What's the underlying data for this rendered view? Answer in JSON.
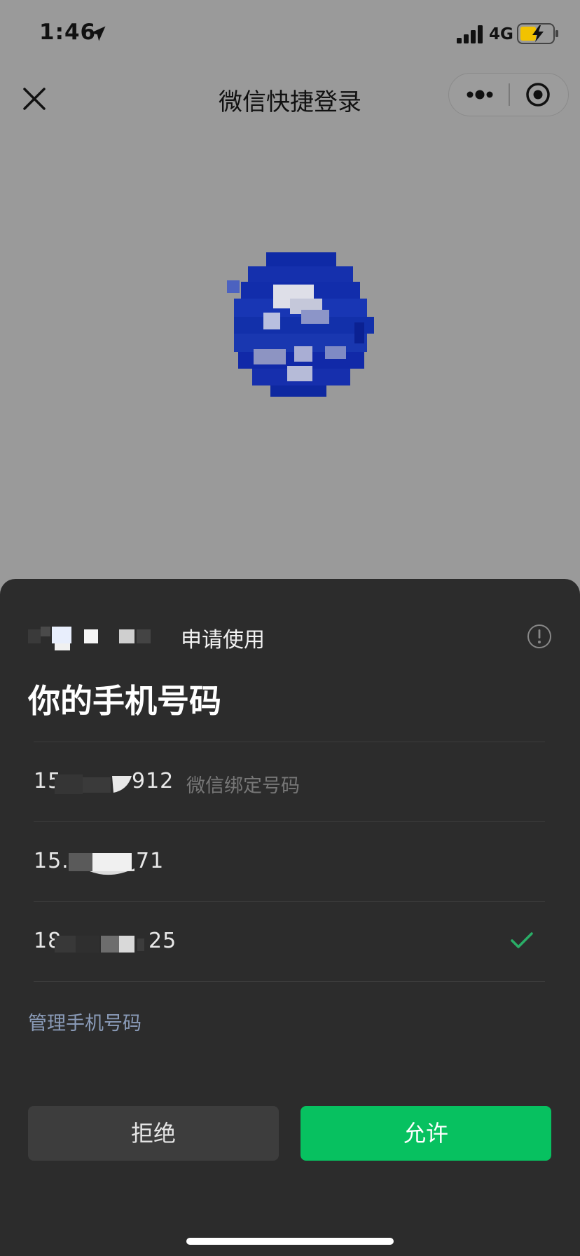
{
  "status_bar": {
    "time": "1:46",
    "network": "4G",
    "icons": [
      "location-arrow-icon",
      "signal-bars-icon",
      "battery-charging-icon"
    ]
  },
  "nav": {
    "title": "微信快捷登录",
    "icons": [
      "close-icon",
      "more-dots-icon",
      "target-icon"
    ]
  },
  "logo": {
    "icon": "app-logo-pixelated",
    "color": "#1a33a8"
  },
  "sheet": {
    "request_label": "申请使用",
    "scope_title": "你的手机号码",
    "phones": [
      {
        "prefix": "15",
        "suffix": "912",
        "tag": "微信绑定号码",
        "selected": false
      },
      {
        "prefix": "15.",
        "suffix": "71",
        "tag": "",
        "selected": false
      },
      {
        "prefix": "18",
        "suffix": "25",
        "tag": "",
        "selected": true
      }
    ],
    "manage_link": "管理手机号码",
    "deny_label": "拒绝",
    "allow_label": "允许"
  },
  "colors": {
    "accent_green": "#07c160",
    "check_green": "#2aae67",
    "link_blue_gray": "#8a9bb8",
    "sheet_bg": "#2c2c2c",
    "backdrop": "#9a9a9a"
  }
}
